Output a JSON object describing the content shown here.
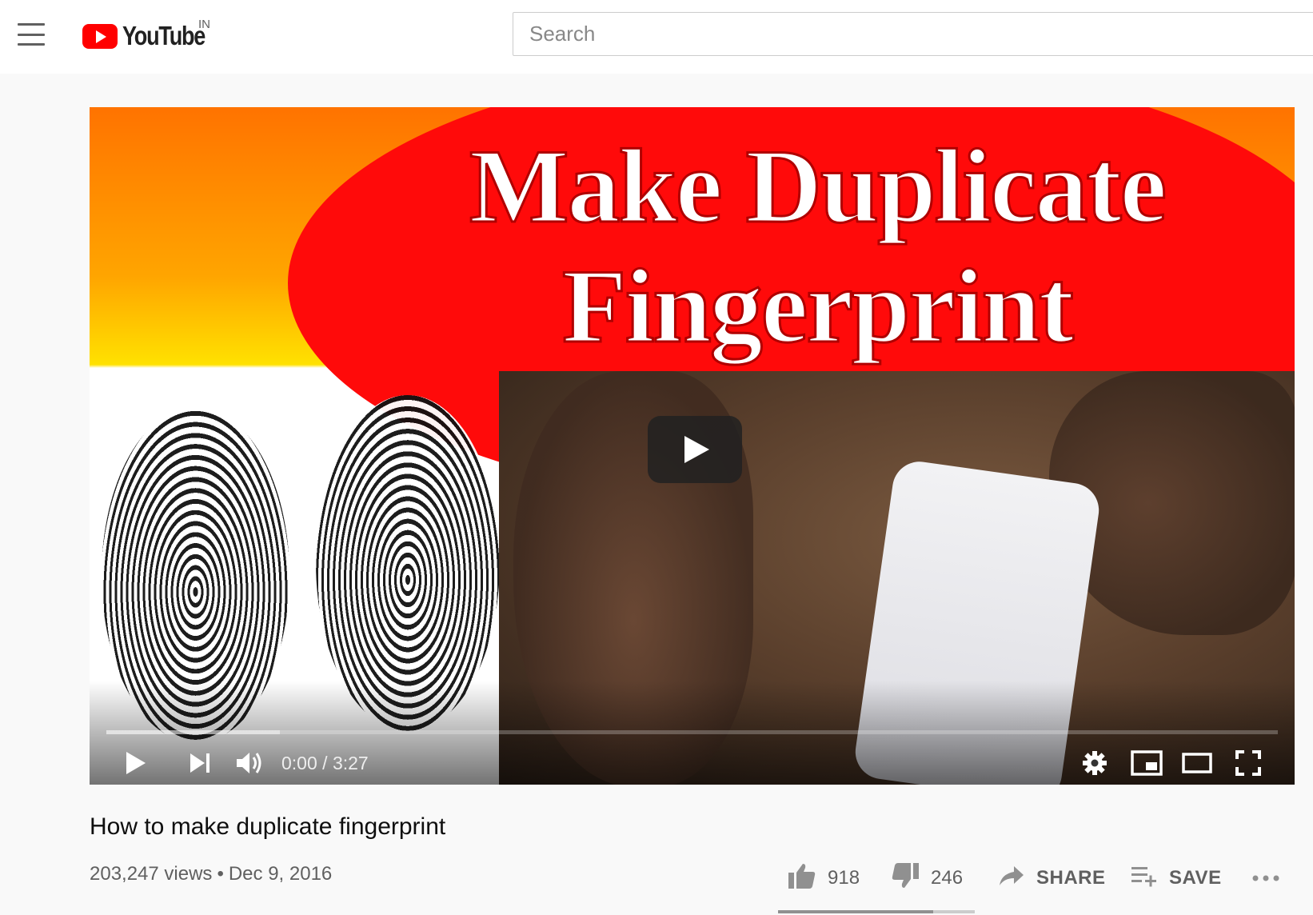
{
  "masthead": {
    "logo_text": "YouTube",
    "country_code": "IN",
    "search_placeholder": "Search"
  },
  "player": {
    "thumbnail_title_line1": "Make Duplicate",
    "thumbnail_title_line2": "Fingerprint",
    "time_current": "0:00",
    "time_separator": " / ",
    "time_total": "3:27",
    "progress_fraction": 0.0,
    "buffered_fraction": 0.148
  },
  "video": {
    "title": "How to make duplicate fingerprint",
    "views": "203,247 views",
    "date": "Dec 9, 2016",
    "separator": "•"
  },
  "actions": {
    "likes": "918",
    "dislikes": "246",
    "share_label": "SHARE",
    "save_label": "SAVE",
    "like_fraction": 0.79
  },
  "colors": {
    "brand_red": "#ff0000",
    "thumbnail_ellipse": "#ff0a0a",
    "text_primary": "#0f0f0f",
    "text_secondary": "#606060",
    "page_background": "#f9f9f9"
  },
  "icons": [
    "menu-icon",
    "youtube-logo-icon",
    "play-icon",
    "next-icon",
    "volume-icon",
    "settings-icon",
    "miniplayer-icon",
    "theater-icon",
    "fullscreen-icon",
    "like-icon",
    "dislike-icon",
    "share-icon",
    "save-playlist-icon",
    "more-icon"
  ]
}
